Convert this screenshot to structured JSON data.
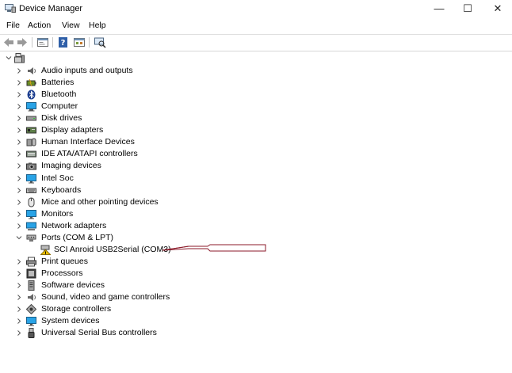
{
  "window": {
    "title": "Device Manager",
    "controls": {
      "minimize": "—",
      "maximize": "☐",
      "close": "✕"
    }
  },
  "menu": {
    "items": [
      {
        "label": "File"
      },
      {
        "label": "Action"
      },
      {
        "label": "View"
      },
      {
        "label": "Help"
      }
    ]
  },
  "tree": {
    "categories": [
      {
        "label": "Audio inputs and outputs",
        "icon": "speaker-icon"
      },
      {
        "label": "Batteries",
        "icon": "battery-icon"
      },
      {
        "label": "Bluetooth",
        "icon": "bluetooth-icon"
      },
      {
        "label": "Computer",
        "icon": "computer-icon"
      },
      {
        "label": "Disk drives",
        "icon": "disk-icon"
      },
      {
        "label": "Display adapters",
        "icon": "display-adapter-icon"
      },
      {
        "label": "Human Interface Devices",
        "icon": "hid-icon"
      },
      {
        "label": "IDE ATA/ATAPI controllers",
        "icon": "ide-icon"
      },
      {
        "label": "Imaging devices",
        "icon": "camera-icon"
      },
      {
        "label": "Intel Soc",
        "icon": "monitor-icon"
      },
      {
        "label": "Keyboards",
        "icon": "keyboard-icon"
      },
      {
        "label": "Mice and other pointing devices",
        "icon": "mouse-icon"
      },
      {
        "label": "Monitors",
        "icon": "monitor-icon"
      },
      {
        "label": "Network adapters",
        "icon": "network-icon"
      },
      {
        "label": "Ports (COM & LPT)",
        "icon": "port-icon",
        "expanded": true,
        "children": [
          {
            "label": "SCI Anroid USB2Serial (COM3)",
            "icon": "warning-port-icon"
          }
        ]
      },
      {
        "label": "Print queues",
        "icon": "printer-icon"
      },
      {
        "label": "Processors",
        "icon": "processor-icon"
      },
      {
        "label": "Software devices",
        "icon": "software-icon"
      },
      {
        "label": "Sound, video and game controllers",
        "icon": "speaker-icon"
      },
      {
        "label": "Storage controllers",
        "icon": "storage-icon"
      },
      {
        "label": "System devices",
        "icon": "monitor-icon"
      },
      {
        "label": "Universal Serial Bus controllers",
        "icon": "usb-icon"
      }
    ]
  },
  "colors": {
    "accent": "#1e73c8",
    "warning": "#f2c200",
    "arrow": "#8b1a2a"
  }
}
